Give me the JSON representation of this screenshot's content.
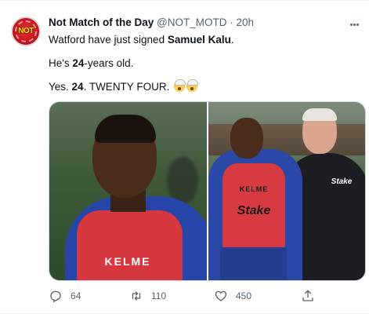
{
  "tweet": {
    "author": {
      "name": "Not Match of the Day",
      "handle": "@NOT_MOTD",
      "separator": "·",
      "time": "20h",
      "avatar_text": "NOT",
      "avatar_icon": "avatar-logo"
    },
    "text": {
      "line1_prefix": "Watford have just signed ",
      "line1_bold": "Samuel Kalu",
      "line1_suffix": ".",
      "line2_prefix": "He's ",
      "line2_bold": "24",
      "line2_suffix": "-years old.",
      "line3_prefix": "Yes. ",
      "line3_bold": "24",
      "line3_suffix": ". TWENTY FOUR."
    },
    "emojis": [
      "exploding-head-emoji",
      "exploding-head-emoji"
    ],
    "media": {
      "left_photo_text": "KELME",
      "right_photo_kelme": "KELME",
      "right_photo_sponsor": "Stake",
      "right_photo_coach_sponsor": "Stake"
    },
    "actions": {
      "reply_count": "64",
      "retweet_count": "110",
      "like_count": "450",
      "share_count": ""
    },
    "colors": {
      "text": "#0f1419",
      "secondary": "#536471",
      "bib_red": "#d7373f",
      "jacket_blue": "#2744a8"
    }
  }
}
